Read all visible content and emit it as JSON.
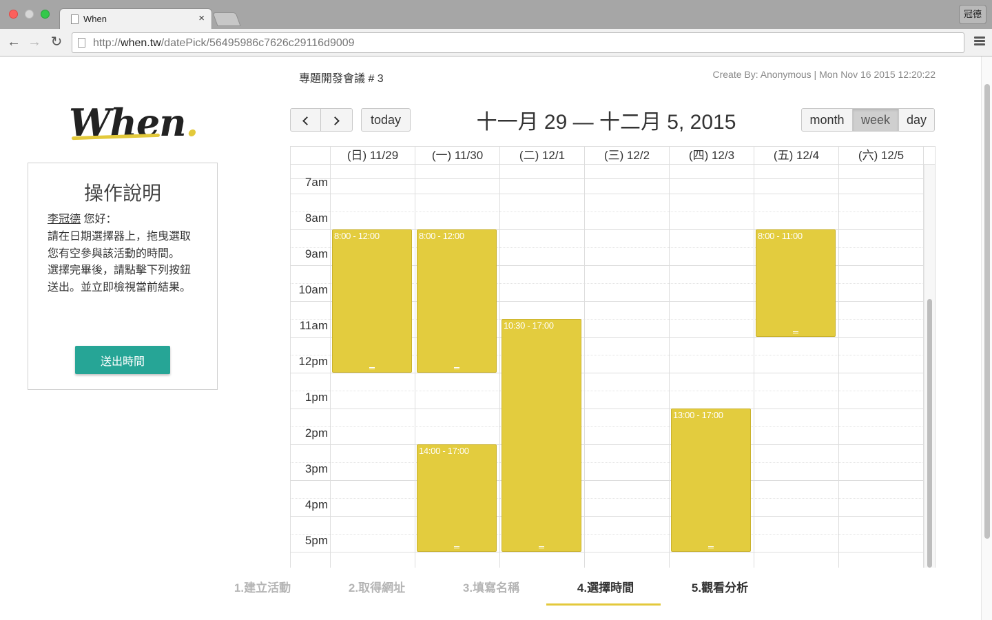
{
  "browser": {
    "tab_title": "When",
    "tab_close": "×",
    "profile_name": "冠德",
    "url_prefix": "http://",
    "url_host": "when.tw",
    "url_path": "/datePick/56495986c7626c29116d9009"
  },
  "sidebar": {
    "logo_text": "When",
    "logo_dot": ".",
    "help_title": "操作說明",
    "user_name": "李冠德",
    "greeting": " 您好：",
    "instructions_1": "請在日期選擇器上，拖曳選取您有空參與該活動的時間。",
    "instructions_2": "選擇完畢後，請點擊下列按鈕送出。並立即檢視當前結果。",
    "submit_label": "送出時間"
  },
  "header": {
    "event_title": "專題開發會議 # 3",
    "meta": "Create By: Anonymous | Mon Nov 16 2015 12:20:22"
  },
  "calendar": {
    "range_title": "十一月 29 — 十二月 5, 2015",
    "today_label": "today",
    "view_month": "month",
    "view_week": "week",
    "view_day": "day",
    "active_view": "week",
    "days": [
      "(日) 11/29",
      "(一) 11/30",
      "(二) 12/1",
      "(三) 12/2",
      "(四) 12/3",
      "(五) 12/4",
      "(六) 12/5"
    ],
    "time_labels": [
      "7am",
      "8am",
      "9am",
      "10am",
      "11am",
      "12pm",
      "1pm",
      "2pm",
      "3pm",
      "4pm",
      "5pm"
    ],
    "events": [
      {
        "day": 0,
        "label": "8:00 - 12:00",
        "start": 8.0,
        "end": 12.0
      },
      {
        "day": 1,
        "label": "8:00 - 12:00",
        "start": 8.0,
        "end": 12.0
      },
      {
        "day": 1,
        "label": "14:00 - 17:00",
        "start": 14.0,
        "end": 17.0
      },
      {
        "day": 2,
        "label": "10:30 - 17:00",
        "start": 10.5,
        "end": 17.0
      },
      {
        "day": 4,
        "label": "13:00 - 17:00",
        "start": 13.0,
        "end": 17.0
      },
      {
        "day": 5,
        "label": "8:00 - 11:00",
        "start": 8.0,
        "end": 11.0
      }
    ],
    "event_color": "#e3cc3e"
  },
  "steps": {
    "items": [
      "1.建立活動",
      "2.取得網址",
      "3.填寫名稱",
      "4.選擇時間",
      "5.觀看分析"
    ],
    "active_index": 3,
    "accent_color": "#e3c93b"
  },
  "icons": {
    "back": "arrow-left-icon",
    "forward": "arrow-right-icon",
    "reload": "reload-icon",
    "menu": "hamburger-menu-icon",
    "prev": "chevron-left-icon",
    "next": "chevron-right-icon"
  }
}
